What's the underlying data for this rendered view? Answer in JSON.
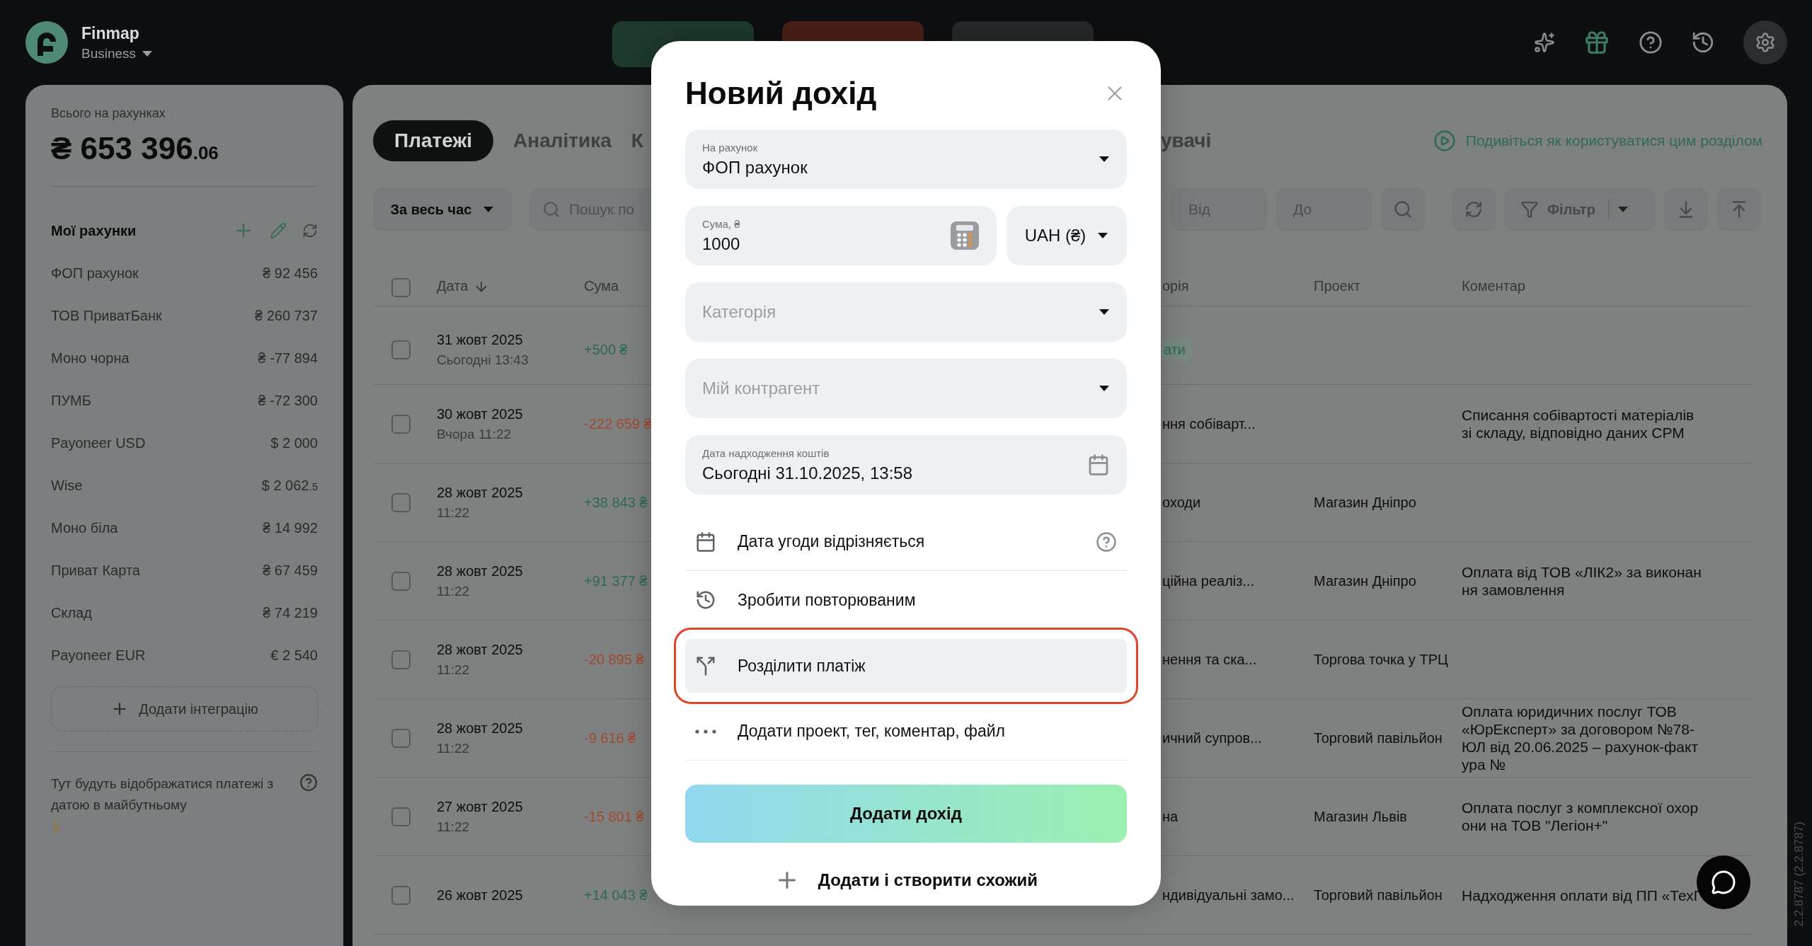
{
  "app": {
    "name": "Finmap",
    "plan": "Business"
  },
  "top_actions": [
    {
      "kind": "income"
    },
    {
      "kind": "expense"
    },
    {
      "kind": "transfer"
    }
  ],
  "summary": {
    "label": "Всього на рахунках",
    "currency": "₴",
    "amount": "653 396",
    "cents": ".06"
  },
  "accounts_title": "Мої рахунки",
  "accounts": [
    {
      "name": "ФОП рахунок",
      "balance": "₴ 92 456"
    },
    {
      "name": "ТОВ ПриватБанк",
      "balance": "₴ 260 737"
    },
    {
      "name": "Моно чорна",
      "balance": "₴ -77 894"
    },
    {
      "name": "ПУМБ",
      "balance": "₴ -72 300"
    },
    {
      "name": "Payoneer USD",
      "balance": "$  2 000"
    },
    {
      "name": "Wise",
      "balance": "$  2 062",
      "fraction": ".5"
    },
    {
      "name": "Моно біла",
      "balance": "₴ 14 992"
    },
    {
      "name": "Приват Карта",
      "balance": "₴ 67 459"
    },
    {
      "name": "Склад",
      "balance": "₴ 74 219"
    },
    {
      "name": "Payoneer EUR",
      "balance": "€ 2 540"
    }
  ],
  "add_integration": "Додати інтеграцію",
  "future_note": "Тут будуть відображатися платежі з датою в майбутньому",
  "tabs": [
    {
      "label": "Платежі",
      "selected": true
    },
    {
      "label": "Аналітика",
      "selected": false
    },
    {
      "label": "К",
      "selected": false
    }
  ],
  "tab_after_modal": {
    "label": "увачі",
    "selected": false
  },
  "help_link": "Подивіться як користуватися цим розділом",
  "period": "За весь час",
  "search": {
    "placeholder": "Пошук по"
  },
  "from": {
    "placeholder": "Від"
  },
  "to": {
    "placeholder": "До"
  },
  "filter": "Фільтр",
  "columns": [
    {
      "label": "Дата",
      "sorted": true
    },
    {
      "label": "Сума",
      "sorted": false
    },
    {
      "label": "орія",
      "sorted": false
    },
    {
      "label": "Проект",
      "sorted": false
    },
    {
      "label": "Коментар",
      "sorted": false
    }
  ],
  "header_checked": false,
  "rows": [
    {
      "checked": false,
      "date": "31 жовт 2025",
      "time": "Сьогодні 13:43",
      "amount": "+500 ₴",
      "kind": "income",
      "category": {
        "text": "ати",
        "kind": "tag"
      }
    },
    {
      "checked": false,
      "date": "30 жовт 2025",
      "time": "Вчора 11:22",
      "amount": "-222 659 ₴",
      "kind": "expense",
      "category": {
        "text": "ння собіварт...",
        "kind": "plain"
      },
      "comment": "Списання собівартості матеріалів зі складу, відповідно даних СРМ"
    },
    {
      "checked": false,
      "date": "28 жовт 2025",
      "time": "11:22",
      "amount": "+38 843 ₴",
      "kind": "income",
      "category": {
        "text": "оходи",
        "kind": "plain"
      },
      "project": "Магазин Дніпро"
    },
    {
      "checked": false,
      "date": "28 жовт 2025",
      "time": "11:22",
      "amount": "+91 377 ₴",
      "kind": "income",
      "category": {
        "text": "ційна реаліз...",
        "kind": "plain"
      },
      "project": "Магазин Дніпро",
      "comment": "Оплата від ТОВ «ЛІК2» за виконання замовлення"
    },
    {
      "checked": false,
      "date": "28 жовт 2025",
      "time": "11:22",
      "amount": "-20 895 ₴",
      "kind": "expense",
      "category": {
        "text": "нення та ска...",
        "kind": "plain"
      },
      "project": "Торгова точка у ТРЦ"
    },
    {
      "checked": false,
      "date": "28 жовт 2025",
      "time": "11:22",
      "amount": "-9 616 ₴",
      "kind": "expense",
      "category": {
        "text": "ичний супров...",
        "kind": "plain"
      },
      "project": "Торговий павільйон",
      "comment": "Оплата юридичних послуг ТОВ «ЮрЕксперт» за договором №78-ЮЛ від 20.06.2025 – рахунок-фактура №"
    },
    {
      "checked": false,
      "date": "27 жовт 2025",
      "time": "11:22",
      "amount": "-15 801 ₴",
      "kind": "expense",
      "category": {
        "text": "на",
        "kind": "plain"
      },
      "project": "Магазин Львів",
      "comment": "Оплата послуг з комплексної охорони на ТОВ \"Легіон+\""
    },
    {
      "checked": false,
      "date": "26 жовт 2025",
      "amount": "+14 043 ₴",
      "kind": "income",
      "category": {
        "text": "ндивідуальні замо...",
        "kind": "plain"
      },
      "project": "Торговий павільйон",
      "comment": "Надходження оплати від ПП «ТехГ"
    }
  ],
  "modal": {
    "title": "Новий дохід",
    "fields": [
      {
        "kind": "select",
        "label": "На рахунок",
        "value": "ФОП рахунок"
      },
      {
        "kind": "amount",
        "label": "Сума, ₴",
        "value": "1000"
      },
      {
        "kind": "select",
        "placeholder": "Категорія"
      },
      {
        "kind": "select",
        "placeholder": "Мій контрагент"
      },
      {
        "kind": "date",
        "label": "Дата надходження коштів",
        "value": "Сьогодні 31.10.2025, 13:58"
      }
    ],
    "currency": "UAH (₴)",
    "options": [
      {
        "kind": "calendar",
        "label": "Дата угоди відрізняється",
        "selected": false,
        "has_help": true
      },
      {
        "kind": "repeat",
        "label": "Зробити повторюваним",
        "selected": false
      },
      {
        "kind": "split",
        "label": "Розділити платіж",
        "selected": true
      },
      {
        "kind": "more",
        "label": "Додати проект, тег, коментар, файл",
        "selected": false
      }
    ],
    "submit": "Додати дохід",
    "secondary": "Додати і створити схожий"
  },
  "version": "2.2.8787 (2.2.8787)"
}
